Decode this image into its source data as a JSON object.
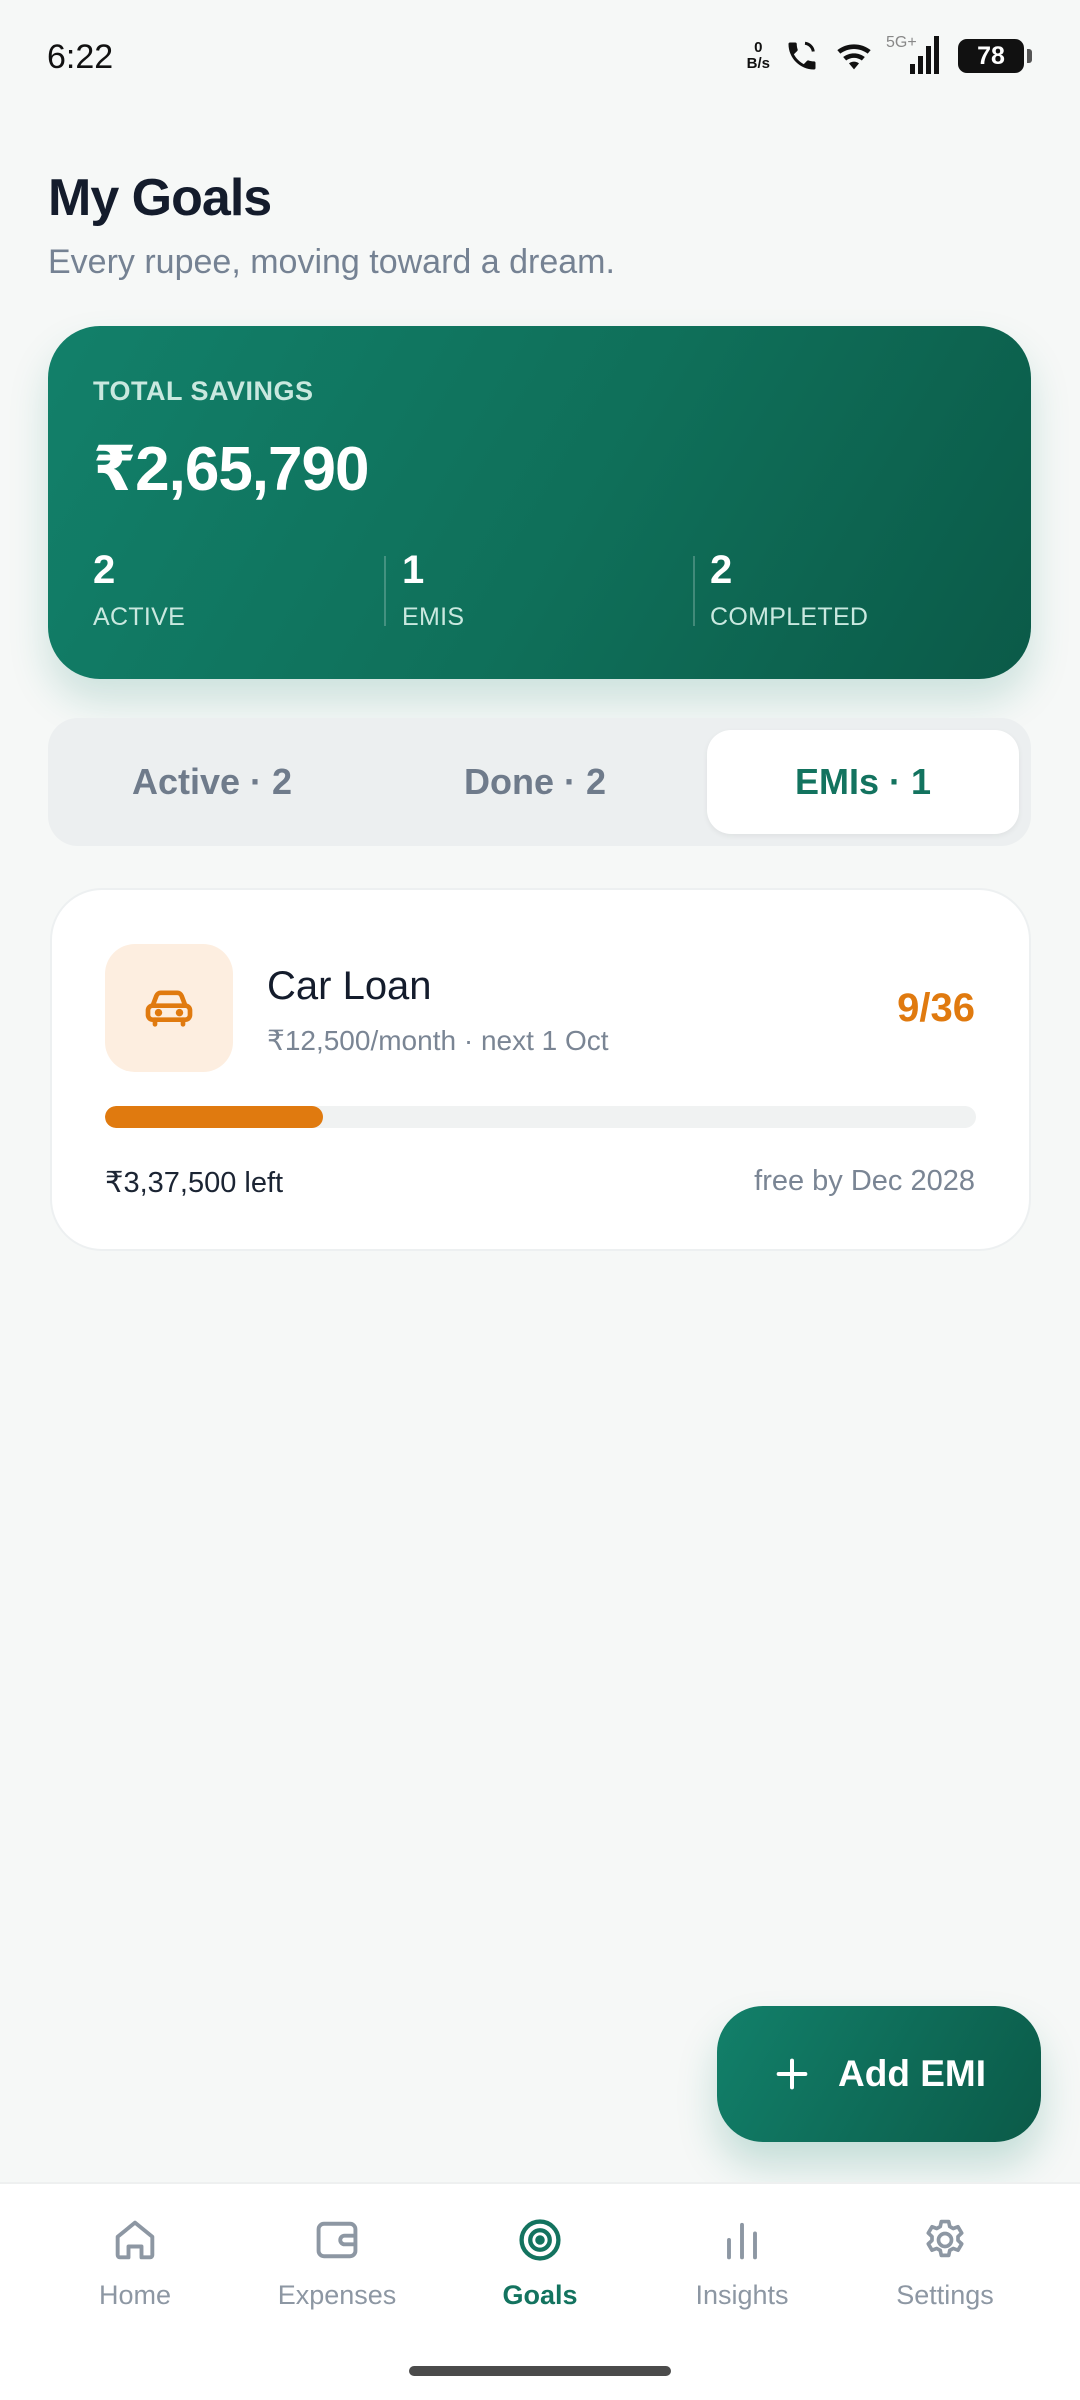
{
  "status_bar": {
    "time": "6:22",
    "net_speed_value": "0",
    "net_speed_unit": "B/s",
    "network_label": "5G+",
    "battery": "78"
  },
  "header": {
    "title": "My Goals",
    "subtitle": "Every rupee, moving toward a dream."
  },
  "savings_card": {
    "label": "TOTAL SAVINGS",
    "amount": "₹2,65,790",
    "stats": [
      {
        "value": "2",
        "label": "ACTIVE"
      },
      {
        "value": "1",
        "label": "EMIS"
      },
      {
        "value": "2",
        "label": "COMPLETED"
      }
    ]
  },
  "tabs": [
    {
      "label": "Active · 2",
      "selected": false
    },
    {
      "label": "Done · 2",
      "selected": false
    },
    {
      "label": "EMIs · 1",
      "selected": true
    }
  ],
  "emi": {
    "icon": "car-icon",
    "title": "Car Loan",
    "subtitle": "₹12,500/month · next 1 Oct",
    "count": "9/36",
    "progress_fraction": 0.25,
    "remaining": "₹3,37,500 left",
    "free_by": "free by Dec 2028"
  },
  "fab": {
    "icon": "plus-icon",
    "label": "Add EMI"
  },
  "bottom_nav": [
    {
      "label": "Home",
      "icon": "home-icon",
      "active": false
    },
    {
      "label": "Expenses",
      "icon": "wallet-icon",
      "active": false
    },
    {
      "label": "Goals",
      "icon": "target-icon",
      "active": true
    },
    {
      "label": "Insights",
      "icon": "bar-chart-icon",
      "active": false
    },
    {
      "label": "Settings",
      "icon": "gear-icon",
      "active": false
    }
  ],
  "colors": {
    "primary": "#13735f",
    "accent_orange": "#e07a0f",
    "background": "#f6f8f7"
  }
}
